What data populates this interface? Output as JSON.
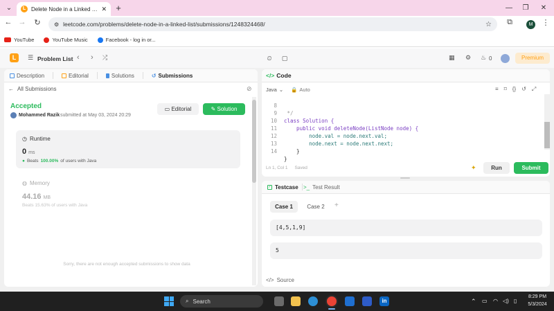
{
  "browser": {
    "tab_title": "Delete Node in a Linked List - L",
    "url": "leetcode.com/problems/delete-node-in-a-linked-list/submissions/1248324468/",
    "profile_initial": "M",
    "bookmarks": [
      "YouTube",
      "YouTube Music",
      "Facebook - log in or..."
    ]
  },
  "lc_header": {
    "problem_list": "Problem List",
    "streak_count": "0",
    "premium_label": "Premium"
  },
  "left_tabs": [
    "Description",
    "Editorial",
    "Solutions",
    "Submissions"
  ],
  "submission": {
    "back_label": "All Submissions",
    "status": "Accepted",
    "author": "Mohammed Razik",
    "submitted_at": "submitted at May 03, 2024 20:29",
    "editorial_button": "Editorial",
    "solution_button": "Solution",
    "runtime": {
      "title": "Runtime",
      "value": "0",
      "unit": "ms",
      "beats_label": "Beats",
      "beats_pct": "100.00%",
      "beats_suffix": "of users with Java"
    },
    "memory": {
      "title": "Memory",
      "value": "44.16",
      "unit": "MB",
      "beats_text": "Beats 15.63% of users with Java"
    },
    "no_data_msg": "Sorry, there are not enough accepted submissions to show data"
  },
  "code": {
    "panel_title": "Code",
    "language": "Java",
    "mode": "Auto",
    "lines": [
      {
        "num": "8",
        "text": " */"
      },
      {
        "num": "9",
        "text": "class Solution {"
      },
      {
        "num": "10",
        "text": "    public void deleteNode(ListNode node) {"
      },
      {
        "num": "11",
        "text": "        node.val = node.next.val;"
      },
      {
        "num": "12",
        "text": "        node.next = node.next.next;"
      },
      {
        "num": "13",
        "text": "    }"
      },
      {
        "num": "14",
        "text": "}"
      }
    ],
    "status_position": "Ln 1, Col 1",
    "status_saved": "Saved",
    "run_button": "Run",
    "submit_button": "Submit"
  },
  "testcase": {
    "tab_testcase": "Testcase",
    "tab_result": "Test Result",
    "cases": [
      "Case 1",
      "Case 2"
    ],
    "add_symbol": "+",
    "input_value": "[4,5,1,9]",
    "param_value": "5",
    "source_label": "Source"
  },
  "taskbar": {
    "search_label": "Search",
    "time": "8:29 PM",
    "date": "5/3/2024"
  },
  "colors": {
    "accent_green": "#2cbb5d",
    "leetcode_orange": "#ffa116",
    "tab_bar": "#f7d6ea"
  }
}
